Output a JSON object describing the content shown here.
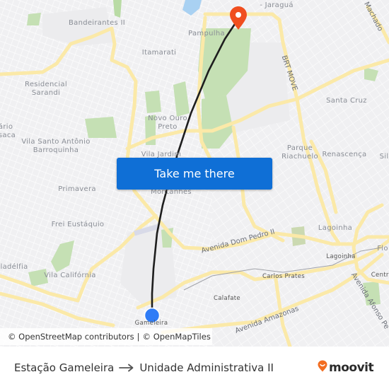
{
  "map": {
    "places": [
      {
        "id": "bandeirantes",
        "label": "Bandeirantes II"
      },
      {
        "id": "pampulha",
        "label": "Pampulha"
      },
      {
        "id": "jaragua",
        "label": "- Jaraguá"
      },
      {
        "id": "itamarati",
        "label": "Itamarati"
      },
      {
        "id": "residencial-sarandi",
        "label": "Residencial\nSarandi"
      },
      {
        "id": "novo-ouro-preto",
        "label": "Novo Ouro\nPreto"
      },
      {
        "id": "santa-cruz",
        "label": "Santa Cruz"
      },
      {
        "id": "dario-sesaca",
        "label": "ário\nsaca"
      },
      {
        "id": "vila-santo-antonio",
        "label": "Vila Santo Antônio\nBarroquinha"
      },
      {
        "id": "vila-jardim",
        "label": "Vila Jardim"
      },
      {
        "id": "parque-riachuelo",
        "label": "Parque\nRiachuelo"
      },
      {
        "id": "renascenca",
        "label": "Renascença"
      },
      {
        "id": "silveira",
        "label": "Sil"
      },
      {
        "id": "primavera",
        "label": "Primavera"
      },
      {
        "id": "montanhes",
        "label": "Montanhês"
      },
      {
        "id": "frei-eustaquio",
        "label": "Frei Eustáquio"
      },
      {
        "id": "lagoinha-area",
        "label": "Lagoinha"
      },
      {
        "id": "floresta",
        "label": "Flo"
      },
      {
        "id": "filadelfia",
        "label": "ladélfia"
      },
      {
        "id": "vila-california",
        "label": "Vila Califórnia"
      },
      {
        "id": "lagoinha-station",
        "label": "Lagoinha"
      },
      {
        "id": "carlos-prates",
        "label": "Carlos Prates"
      },
      {
        "id": "centro",
        "label": "Centra"
      },
      {
        "id": "calafate",
        "label": "Calafate"
      },
      {
        "id": "gameleira",
        "label": "Gameleira"
      }
    ],
    "streets": [
      {
        "id": "brt-move",
        "label": "BRT MOVE"
      },
      {
        "id": "machado",
        "label": "Machado"
      },
      {
        "id": "dom-pedro",
        "label": "Avenida Dom Pedro II"
      },
      {
        "id": "amazonas",
        "label": "Avenida Amazonas"
      },
      {
        "id": "afonso-pena",
        "label": "Avenida Afonso Pe"
      }
    ],
    "origin_marker": {
      "label": "Estação Gameleira",
      "color": "#2f7cf6"
    },
    "destination_marker": {
      "label": "Unidade Administrativa II",
      "color": "#f04e1e"
    },
    "attribution": {
      "osm": "© OpenStreetMap contributors",
      "separator": "|",
      "omt": "© OpenMapTiles"
    }
  },
  "cta": {
    "label": "Take me there",
    "color": "#0f6fd6"
  },
  "footer": {
    "origin": "Estação Gameleira",
    "destination": "Unidade Administrativa II",
    "arrow_icon": "arrow-right-icon",
    "logo_text": "moovit",
    "logo_color": "#f26d21"
  }
}
